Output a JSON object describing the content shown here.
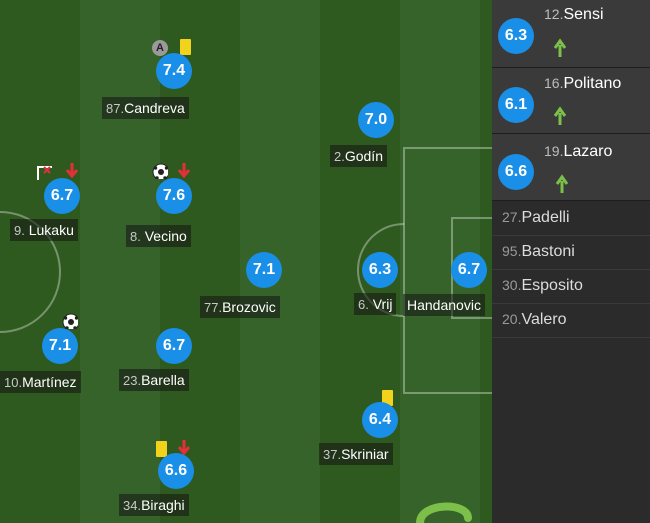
{
  "players": [
    {
      "id": "candreva",
      "number": "87.",
      "name": "Candreva",
      "rating": "7.4"
    },
    {
      "id": "godin",
      "number": "2.",
      "name": "Godín",
      "rating": "7.0"
    },
    {
      "id": "lukaku",
      "number": "9.",
      "name": "Lukaku",
      "rating": "6.7"
    },
    {
      "id": "vecino",
      "number": "8.",
      "name": "Vecino",
      "rating": "7.6"
    },
    {
      "id": "brozovic",
      "number": "77.",
      "name": "Brozovic",
      "rating": "7.1"
    },
    {
      "id": "vrij",
      "number": "6.",
      "name": "Vrij",
      "rating": "6.3"
    },
    {
      "id": "handanovic",
      "number": "",
      "name": "Handanovic",
      "rating": "6.7"
    },
    {
      "id": "martinez",
      "number": "10.",
      "name": "Martínez",
      "rating": "7.1"
    },
    {
      "id": "barella",
      "number": "23.",
      "name": "Barella",
      "rating": "6.7"
    },
    {
      "id": "skriniar",
      "number": "37.",
      "name": "Skriniar",
      "rating": "6.4"
    },
    {
      "id": "biraghi",
      "number": "34.",
      "name": "Biraghi",
      "rating": "6.6"
    }
  ],
  "substitutes": [
    {
      "number": "12.",
      "name": "Sensi",
      "rating": "6.3"
    },
    {
      "number": "16.",
      "name": "Politano",
      "rating": "6.1"
    },
    {
      "number": "19.",
      "name": "Lazaro",
      "rating": "6.6"
    }
  ],
  "bench": [
    {
      "number": "27.",
      "name": "Padelli"
    },
    {
      "number": "95.",
      "name": "Bastoni"
    },
    {
      "number": "30.",
      "name": "Esposito"
    },
    {
      "number": "20.",
      "name": "Valero"
    }
  ],
  "icons": {
    "yellow_card": "#f2d21b",
    "sub_out_arrow": "#e0303a",
    "sub_in_arrow": "#7cc04a",
    "assist_badge": "A",
    "goal": "soccer-ball-icon"
  },
  "colors": {
    "rating_badge": "#1a8fe8",
    "pitch_dark": "#2f5a1f",
    "pitch_light": "#35632a",
    "sidebar_bg": "#2b2b2b",
    "sub_row_bg": "#3a3a3a"
  }
}
